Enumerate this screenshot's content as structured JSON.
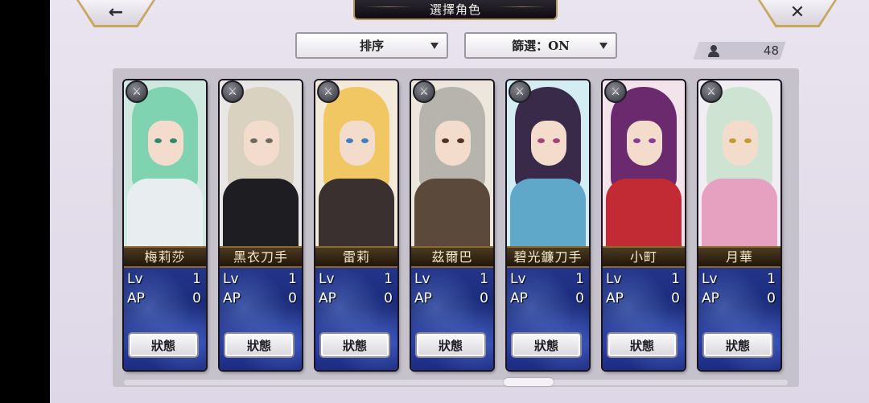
{
  "header": {
    "title": "選擇角色",
    "back_icon": "←",
    "close_icon": "✕"
  },
  "controls": {
    "sort_label": "排序",
    "filter_label": "篩選：ON",
    "character_count": "48"
  },
  "labels": {
    "lv": "Lv",
    "ap": "AP",
    "status_button": "狀態"
  },
  "characters": [
    {
      "name": "梅莉莎",
      "lv": "1",
      "ap": "0",
      "hair": "#7fd3b0",
      "outfit": "#e8eef0",
      "eye": "#2e8a6a",
      "bg": "#cfe8e0"
    },
    {
      "name": "黑衣刀手",
      "lv": "1",
      "ap": "0",
      "hair": "#d9d2c0",
      "outfit": "#1d1d22",
      "eye": "#6d6a60",
      "bg": "#e9e7e6"
    },
    {
      "name": "雷莉",
      "lv": "1",
      "ap": "0",
      "hair": "#f0c762",
      "outfit": "#3b3030",
      "eye": "#3d7fc2",
      "bg": "#f3eadb"
    },
    {
      "name": "茲爾巴",
      "lv": "1",
      "ap": "0",
      "hair": "#b7b4ad",
      "outfit": "#5b4a3c",
      "eye": "#553322",
      "bg": "#ede6dc"
    },
    {
      "name": "碧光鐮刀手",
      "lv": "1",
      "ap": "0",
      "hair": "#3a2a4a",
      "outfit": "#5fa8c9",
      "eye": "#a8407a",
      "bg": "#d3edf2"
    },
    {
      "name": "小町",
      "lv": "1",
      "ap": "0",
      "hair": "#6b2a6e",
      "outfit": "#c22b33",
      "eye": "#8a3a9a",
      "bg": "#f2e4ea"
    },
    {
      "name": "月華",
      "lv": "1",
      "ap": "0",
      "hair": "#cfe3d2",
      "outfit": "#e7a1c0",
      "eye": "#c79a2b",
      "bg": "#f0eef2"
    }
  ]
}
